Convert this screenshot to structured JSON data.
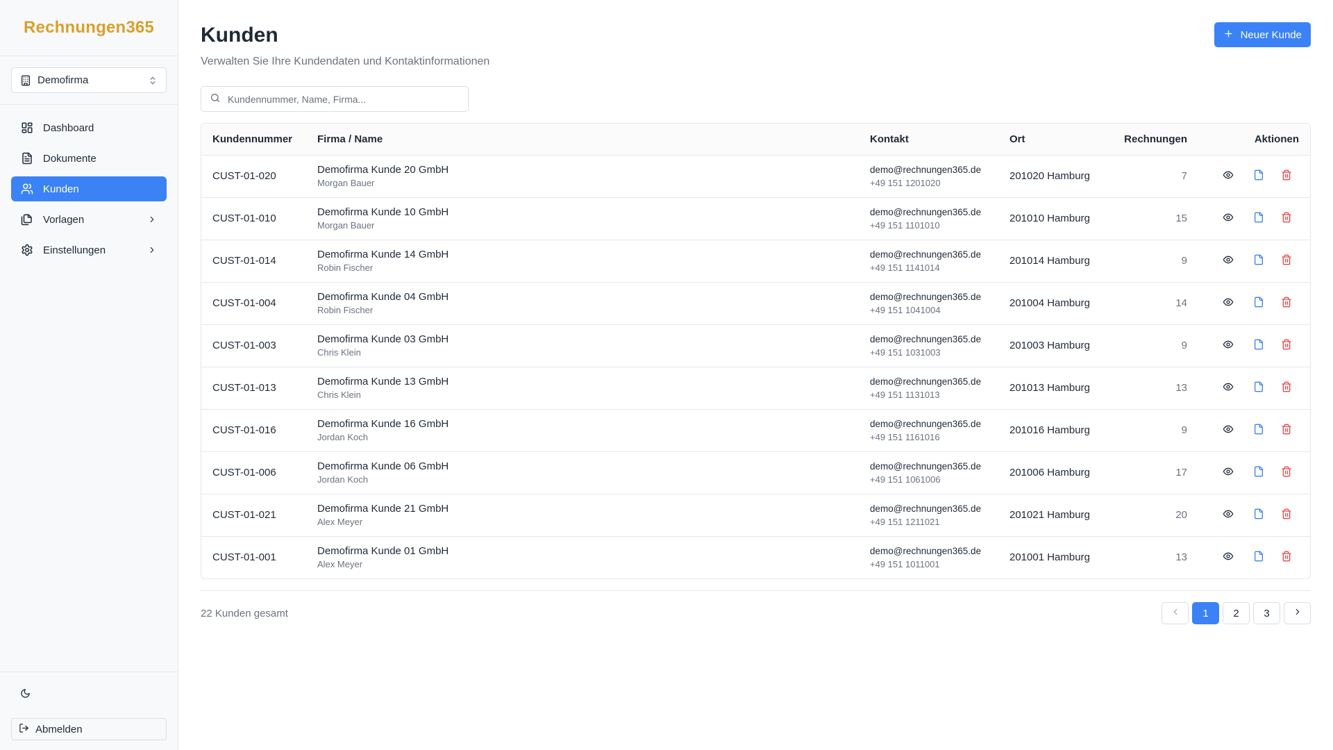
{
  "app": {
    "brand": "Rechnungen365"
  },
  "company_select": {
    "value": "Demofirma"
  },
  "nav": {
    "items": [
      {
        "label": "Dashboard",
        "icon": "dashboard-icon"
      },
      {
        "label": "Dokumente",
        "icon": "document-icon"
      },
      {
        "label": "Kunden",
        "icon": "users-icon",
        "active": true
      },
      {
        "label": "Vorlagen",
        "icon": "templates-icon"
      },
      {
        "label": "Einstellungen",
        "icon": "gear-icon"
      }
    ]
  },
  "sidebar_bottom": {
    "theme_icon": "moon-icon",
    "logout_label": "Abmelden"
  },
  "page": {
    "title": "Kunden",
    "subtitle": "Verwalten Sie Ihre Kundendaten und Kontaktinformationen",
    "new_button": "Neuer Kunde"
  },
  "search": {
    "placeholder": "Kundennummer, Name, Firma...",
    "value": ""
  },
  "table": {
    "headers": [
      "Kundennummer",
      "Firma / Name",
      "Kontakt",
      "Ort",
      "Rechnungen",
      "Aktionen"
    ],
    "rows": [
      {
        "number": "CUST-01-020",
        "firm": "Demofirma Kunde 20 GmbH",
        "name": "Morgan Bauer",
        "email": "demo@rechnungen365.de",
        "phone": "+49 151 1201020",
        "city": "201020 Hamburg",
        "invoices": "7"
      },
      {
        "number": "CUST-01-010",
        "firm": "Demofirma Kunde 10 GmbH",
        "name": "Morgan Bauer",
        "email": "demo@rechnungen365.de",
        "phone": "+49 151 1101010",
        "city": "201010 Hamburg",
        "invoices": "15"
      },
      {
        "number": "CUST-01-014",
        "firm": "Demofirma Kunde 14 GmbH",
        "name": "Robin Fischer",
        "email": "demo@rechnungen365.de",
        "phone": "+49 151 1141014",
        "city": "201014 Hamburg",
        "invoices": "9"
      },
      {
        "number": "CUST-01-004",
        "firm": "Demofirma Kunde 04 GmbH",
        "name": "Robin Fischer",
        "email": "demo@rechnungen365.de",
        "phone": "+49 151 1041004",
        "city": "201004 Hamburg",
        "invoices": "14"
      },
      {
        "number": "CUST-01-003",
        "firm": "Demofirma Kunde 03 GmbH",
        "name": "Chris Klein",
        "email": "demo@rechnungen365.de",
        "phone": "+49 151 1031003",
        "city": "201003 Hamburg",
        "invoices": "9"
      },
      {
        "number": "CUST-01-013",
        "firm": "Demofirma Kunde 13 GmbH",
        "name": "Chris Klein",
        "email": "demo@rechnungen365.de",
        "phone": "+49 151 1131013",
        "city": "201013 Hamburg",
        "invoices": "13"
      },
      {
        "number": "CUST-01-016",
        "firm": "Demofirma Kunde 16 GmbH",
        "name": "Jordan Koch",
        "email": "demo@rechnungen365.de",
        "phone": "+49 151 1161016",
        "city": "201016 Hamburg",
        "invoices": "9"
      },
      {
        "number": "CUST-01-006",
        "firm": "Demofirma Kunde 06 GmbH",
        "name": "Jordan Koch",
        "email": "demo@rechnungen365.de",
        "phone": "+49 151 1061006",
        "city": "201006 Hamburg",
        "invoices": "17"
      },
      {
        "number": "CUST-01-021",
        "firm": "Demofirma Kunde 21 GmbH",
        "name": "Alex Meyer",
        "email": "demo@rechnungen365.de",
        "phone": "+49 151 1211021",
        "city": "201021 Hamburg",
        "invoices": "20"
      },
      {
        "number": "CUST-01-001",
        "firm": "Demofirma Kunde 01 GmbH",
        "name": "Alex Meyer",
        "email": "demo@rechnungen365.de",
        "phone": "+49 151 1011001",
        "city": "201001 Hamburg",
        "invoices": "13"
      }
    ],
    "row_action_icons": [
      "eye-icon",
      "file-icon",
      "trash-icon"
    ]
  },
  "footer": {
    "total": "22 Kunden gesamt",
    "pages": [
      "1",
      "2",
      "3"
    ],
    "current_page": "1"
  },
  "colors": {
    "brand": "#d9a02c",
    "accent": "#3b82f6",
    "danger": "#ef4444"
  }
}
